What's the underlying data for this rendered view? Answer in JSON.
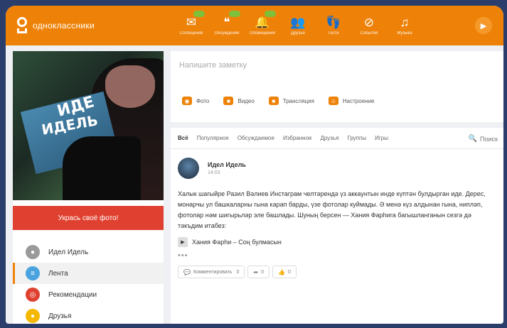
{
  "header": {
    "logo_text": "одноклассники",
    "nav": [
      {
        "label": "Сообщения",
        "icon": "envelope-icon",
        "glyph": "✉",
        "badge": true
      },
      {
        "label": "Обсуждения",
        "icon": "chat-icon",
        "glyph": "❝",
        "badge": true
      },
      {
        "label": "Оповещения",
        "icon": "bell-icon",
        "glyph": "🔔",
        "badge": true
      },
      {
        "label": "Друзья",
        "icon": "friends-icon",
        "glyph": "👥",
        "badge": false
      },
      {
        "label": "Гости",
        "icon": "footprints-icon",
        "glyph": "👣",
        "badge": false
      },
      {
        "label": "События",
        "icon": "events-icon",
        "glyph": "⊘",
        "badge": false
      },
      {
        "label": "Музыка",
        "icon": "music-icon",
        "glyph": "♫",
        "badge": false
      }
    ],
    "play_glyph": "▶"
  },
  "sidebar": {
    "photo_words": [
      "ИДЕ",
      "ИДЕЛЬ",
      ""
    ],
    "decorate_button": "Укрась своё фото!",
    "menu": [
      {
        "label": "Идел Идель",
        "icon": "profile-icon",
        "color": "#9a9a9a",
        "glyph": "●"
      },
      {
        "label": "Лента",
        "icon": "feed-icon",
        "color": "#4aa3df",
        "glyph": "≡"
      },
      {
        "label": "Рекомендации",
        "icon": "recommendations-icon",
        "color": "#e0402f",
        "glyph": "◎"
      },
      {
        "label": "Друзья",
        "icon": "friends-icon",
        "color": "#f5b800",
        "glyph": "●"
      }
    ]
  },
  "composer": {
    "placeholder": "Напишите заметку",
    "actions": [
      {
        "label": "Фото",
        "icon": "camera-icon",
        "glyph": "◉"
      },
      {
        "label": "Видео",
        "icon": "video-icon",
        "glyph": "■"
      },
      {
        "label": "Трансляция",
        "icon": "broadcast-icon",
        "glyph": "■"
      },
      {
        "label": "Настроение",
        "icon": "mood-icon",
        "glyph": "☺"
      }
    ]
  },
  "feed": {
    "tabs": [
      "Всё",
      "Популярное",
      "Обсуждаемое",
      "Избранное",
      "Друзья",
      "Группы",
      "Игры"
    ],
    "search_label": "Поиск",
    "post": {
      "author": "Идел Идель",
      "time": "14:03",
      "text": "Халык шагыйре Разил Вәлиев Инстаграм челтәрендә үз аккаунтын инде күптән булдырган иде. Дерес, монарчы ул башкаларны гына карап барды, үзе фотолар куймады. Ә менә күз алдынан гына, нипләп, фотолар нәм шигырьләр эле башлады. Шуның берсен — Хания Фарһига багышланганын сезгә дә тәкъдим итабез:",
      "track": "Хания Фарһи – Соң булмасын",
      "more": "•••",
      "reactions": [
        {
          "label": "Комментировать",
          "count": "0",
          "icon": "comment-icon",
          "glyph": "💬"
        },
        {
          "label": "",
          "count": "0",
          "icon": "share-icon",
          "glyph": "➦"
        },
        {
          "label": "",
          "count": "0",
          "icon": "like-icon",
          "glyph": "👍"
        }
      ]
    }
  }
}
